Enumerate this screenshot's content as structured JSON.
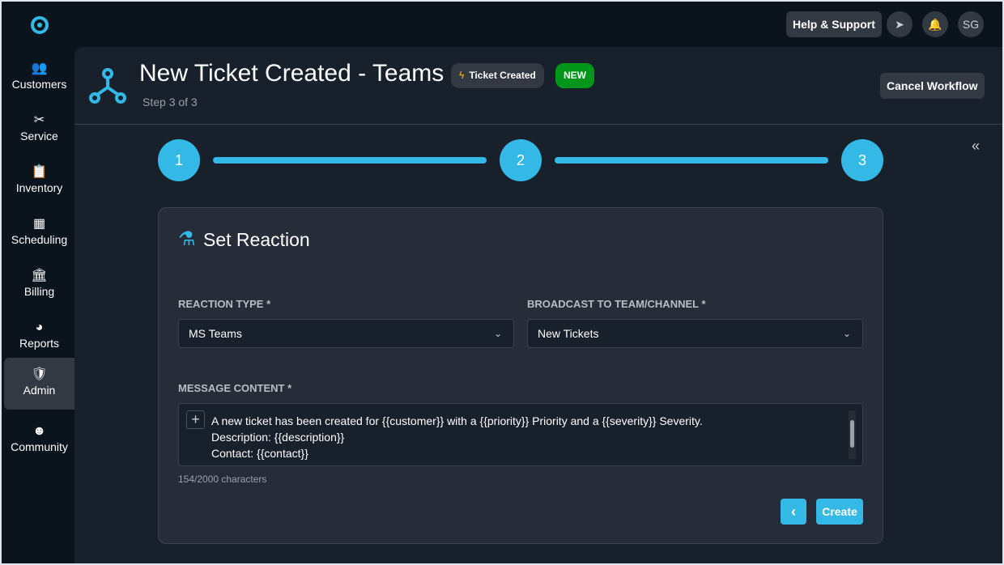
{
  "sidebar": {
    "items": [
      {
        "label": "Customers",
        "icon": "people-icon"
      },
      {
        "label": "Service",
        "icon": "tools-icon"
      },
      {
        "label": "Inventory",
        "icon": "clipboard-check-icon"
      },
      {
        "label": "Scheduling",
        "icon": "calendar-icon"
      },
      {
        "label": "Billing",
        "icon": "bank-icon"
      },
      {
        "label": "Reports",
        "icon": "pie-chart-icon"
      },
      {
        "label": "Admin",
        "icon": "shield-user-icon"
      },
      {
        "label": "Community",
        "icon": "reddit-icon"
      }
    ]
  },
  "topbar": {
    "help": "Help & Support",
    "avatar": "SG"
  },
  "header": {
    "title": "New Ticket Created - Teams",
    "step": "Step 3 of 3",
    "trigger_chip": "Ticket Created",
    "status_chip": "NEW",
    "cancel": "Cancel Workflow",
    "collapse": "«"
  },
  "stepper": {
    "steps": [
      "1",
      "2",
      "3"
    ],
    "current": 3
  },
  "card": {
    "title": "Set Reaction",
    "reaction_type": {
      "label": "REACTION TYPE *",
      "value": "MS Teams"
    },
    "broadcast": {
      "label": "BROADCAST TO TEAM/CHANNEL *",
      "value": "New Tickets"
    },
    "message": {
      "label": "MESSAGE CONTENT *",
      "lines": [
        "A new ticket has been created for {{customer}} with a {{priority}} Priority and a {{severity}} Severity.",
        "Description: {{description}}",
        "Contact: {{contact}}"
      ],
      "count": "154/2000 characters"
    },
    "back": "‹",
    "create": "Create"
  },
  "colors": {
    "accent": "#34b9e6",
    "new": "#00961a",
    "bg": "#0b131d"
  }
}
